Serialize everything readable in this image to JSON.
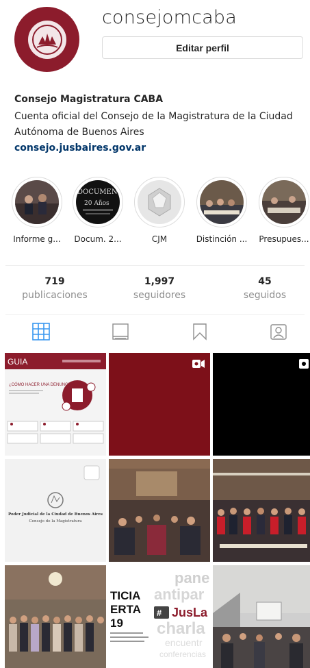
{
  "profile": {
    "username": "consejomcaba",
    "edit_label": "Editar perfil",
    "full_name": "Consejo Magistratura CABA",
    "bio": "Cuenta oficial del Consejo de la Magistratura de la Ciudad Autónoma de Buenos Aires",
    "website": "consejo.jusbaires.gov.ar"
  },
  "highlights": [
    {
      "label": "Informe g..."
    },
    {
      "label": "Docum. 2..."
    },
    {
      "label": "CJM"
    },
    {
      "label": "Distinción ..."
    },
    {
      "label": "Presupues..."
    }
  ],
  "stats": [
    {
      "value": "719",
      "label": "publicaciones"
    },
    {
      "value": "1,997",
      "label": "seguidores"
    },
    {
      "value": "45",
      "label": "seguidos"
    }
  ],
  "tabs": [
    {
      "icon": "grid-icon",
      "active": true
    },
    {
      "icon": "igtv-icon",
      "active": false
    },
    {
      "icon": "saved-icon",
      "active": false
    },
    {
      "icon": "tagged-icon",
      "active": false
    }
  ],
  "highlight_doc": {
    "line1": "DOCUMEN",
    "line2": "20 Años"
  },
  "posts": {
    "p1": {
      "title": "GUIA",
      "heading": "¿CÓMO HACER UNA DENUNCIA?"
    },
    "p4": {
      "line1": "Poder Judicial de la Ciudad de Buenos Aires",
      "line2": "Consejo de la Magistratura"
    },
    "p8": {
      "line1": "TICIA",
      "line2": "ERTA",
      "line3": "19",
      "brand": "JusLa",
      "bg1": "panel",
      "bg2": "antipar",
      "bg3": "charla",
      "bg4": "encuentr",
      "bg5": "conferencias"
    }
  },
  "colors": {
    "brand": "#8c1c2c",
    "link": "#003569",
    "muted": "#8e8e8e",
    "active_tab": "#3897f0"
  }
}
